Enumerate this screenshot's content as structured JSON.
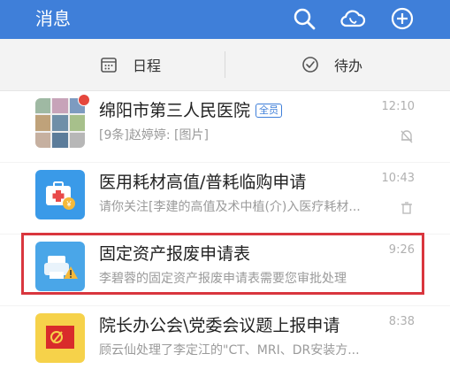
{
  "header": {
    "title": "消息",
    "icons": [
      "search-icon",
      "cloud-phone-icon",
      "plus-circle-icon"
    ]
  },
  "tabs": [
    {
      "label": "日程",
      "icon": "calendar-icon"
    },
    {
      "label": "待办",
      "icon": "check-circle-icon"
    }
  ],
  "conversations": [
    {
      "name": "绵阳市第三人民医院",
      "badge": "全员",
      "snippet": "[9条]赵婷婷: [图片]",
      "time": "12:10",
      "unread_dot": true,
      "muted": true,
      "avatar": "group-photo-grid"
    },
    {
      "name": "医用耗材高值/普耗临购申请",
      "snippet": "请你关注[李建的高值及术中植(介)入医疗耗材...",
      "time": "10:43",
      "avatar": "medical-kit-icon"
    },
    {
      "name": "固定资产报废申请表",
      "snippet": "李碧蓉的固定资产报废申请表需要您审批处理",
      "time": "9:26",
      "avatar": "printer-warning-icon",
      "highlighted": true
    },
    {
      "name": "院长办公会\\党委会议题上报申请",
      "snippet": "顾云仙处理了李定江的\"CT、MRI、DR安装方...",
      "time": "8:38",
      "avatar": "party-emblem-icon"
    }
  ],
  "colors": {
    "header_bg": "#3f7fd9",
    "highlight_border": "#d9363e",
    "unread_dot": "#e5473d"
  }
}
